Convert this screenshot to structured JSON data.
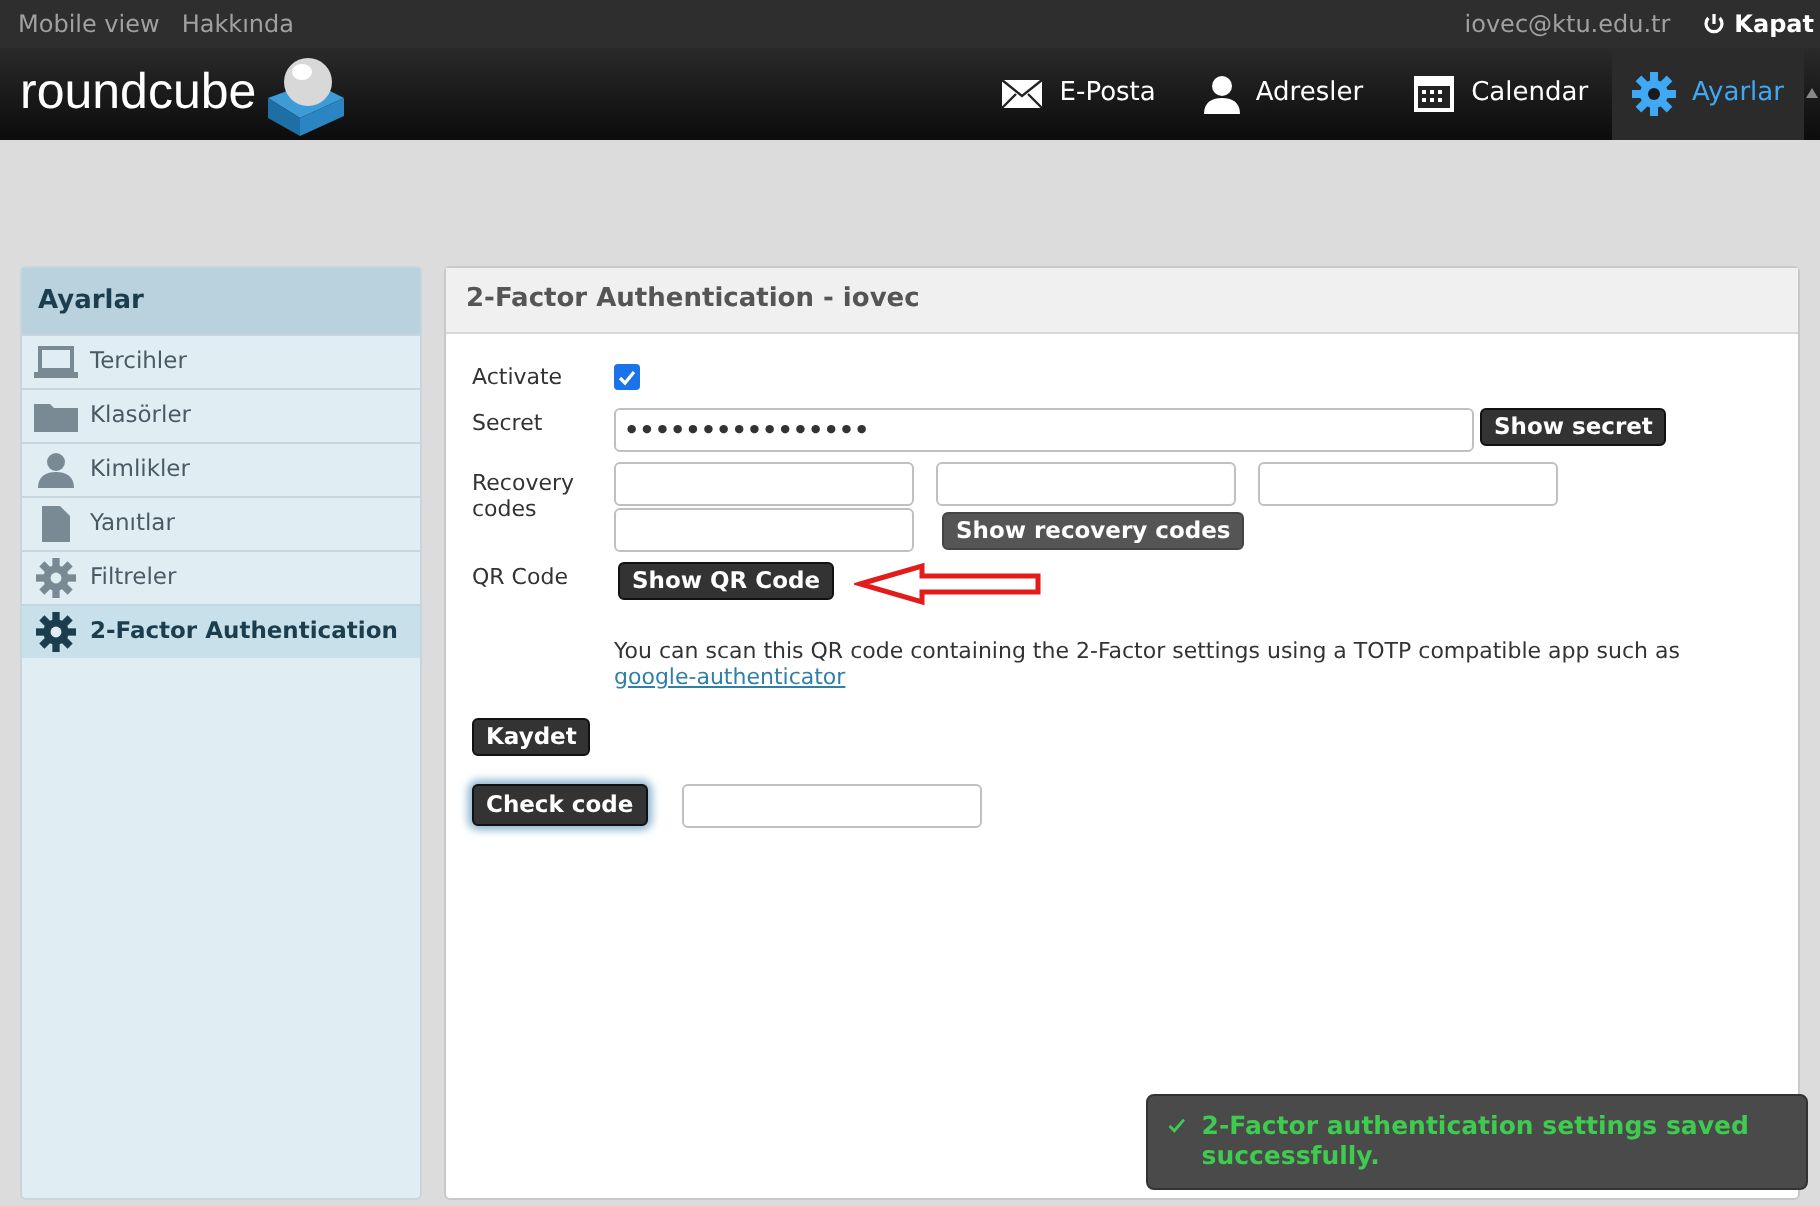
{
  "topbar": {
    "links": [
      "Mobile view",
      "Hakkında"
    ],
    "user": "iovec@ktu.edu.tr",
    "logout": "Kapat"
  },
  "header": {
    "logo": "roundcube",
    "nav": [
      {
        "label": "E-Posta",
        "selected": false
      },
      {
        "label": "Adresler",
        "selected": false
      },
      {
        "label": "Calendar",
        "selected": false
      },
      {
        "label": "Ayarlar",
        "selected": true
      }
    ]
  },
  "sidebar": {
    "title": "Ayarlar",
    "items": [
      {
        "label": "Tercihler",
        "selected": false
      },
      {
        "label": "Klasörler",
        "selected": false
      },
      {
        "label": "Kimlikler",
        "selected": false
      },
      {
        "label": "Yanıtlar",
        "selected": false
      },
      {
        "label": "Filtreler",
        "selected": false
      },
      {
        "label": "2-Factor Authentication",
        "selected": true
      }
    ]
  },
  "panel": {
    "title": "2-Factor Authentication - iovec",
    "activate": {
      "label": "Activate",
      "checked": true
    },
    "secret": {
      "label": "Secret",
      "value": "••••••••••••••••",
      "button": "Show secret"
    },
    "recovery": {
      "label": "Recovery codes",
      "button": "Show recovery codes",
      "disabled": true
    },
    "qr": {
      "label": "QR Code",
      "button": "Show QR Code"
    },
    "hint": {
      "text": "You can scan this QR code containing the 2-Factor settings using a TOTP compatible app such as",
      "link": "google-authenticator"
    },
    "save": "Kaydet",
    "check": {
      "button": "Check code",
      "focused": true
    }
  },
  "toast": {
    "message": "2-Factor authentication settings saved successfully."
  }
}
